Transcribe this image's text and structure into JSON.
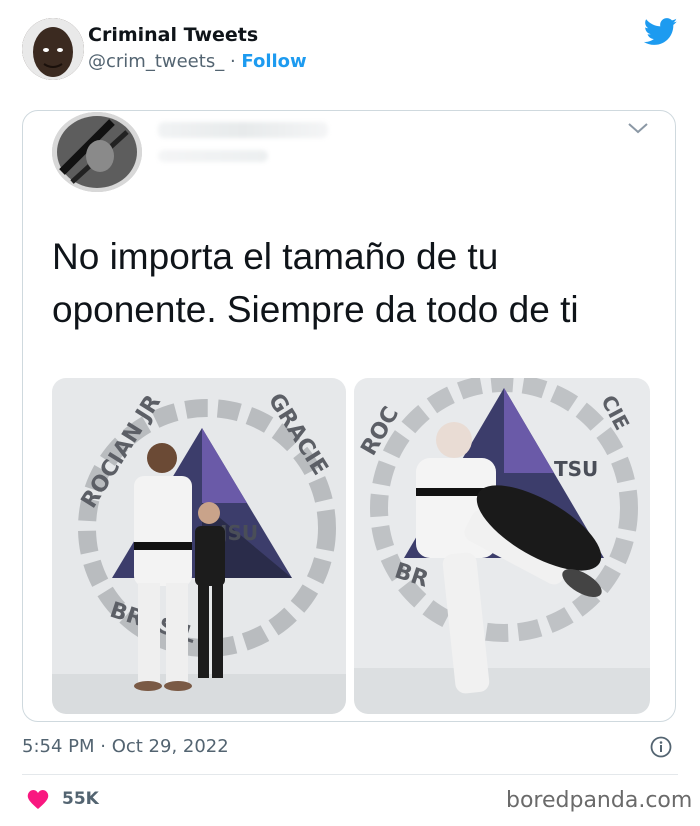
{
  "header": {
    "display_name": "Criminal Tweets",
    "handle": "@crim_tweets_",
    "separator": "·",
    "follow_label": "Follow"
  },
  "quoted_tweet": {
    "text": "No importa el tamaño de tu oponente. Siempre da todo de ti",
    "photo_left_banner": [
      "ROCIAN JR",
      "GRACIE",
      "JSU",
      "BRASIL"
    ],
    "photo_right_banner": [
      "ROC",
      "CIE",
      "TSU",
      "BR"
    ]
  },
  "footer": {
    "timestamp": "5:54 PM · Oct 29, 2022",
    "likes": "55K",
    "watermark": "boredpanda.com"
  },
  "colors": {
    "accent": "#1d9bf0",
    "like": "#f91880",
    "muted": "#536471",
    "border": "#cfd9de"
  },
  "icons": [
    "twitter-bird-icon",
    "chevron-down-icon",
    "info-icon",
    "heart-icon"
  ]
}
